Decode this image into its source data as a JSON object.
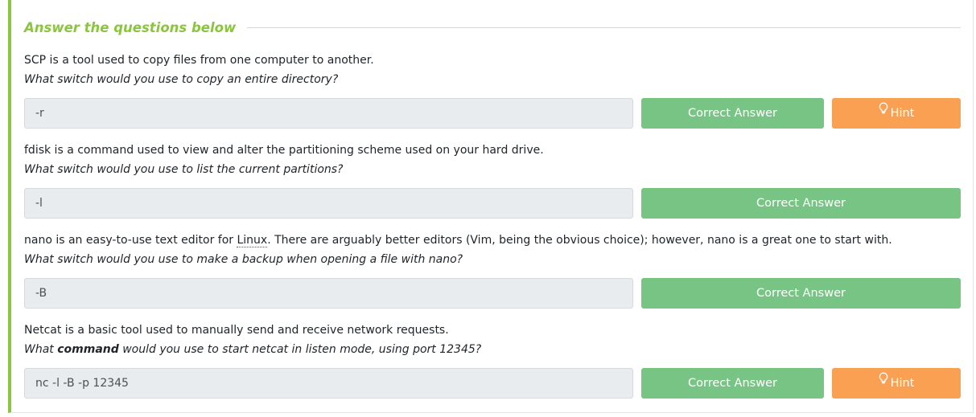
{
  "section": {
    "heading": "Answer the questions below"
  },
  "questions": [
    {
      "text": "SCP is a tool used to copy files from one computer to another.",
      "ask": "What switch would you use to copy an entire directory?",
      "answer": "-r",
      "button": "Correct Answer",
      "hint": "Hint"
    },
    {
      "text": "fdisk is a command used to view and alter the partitioning scheme used on your hard drive.",
      "ask": "What switch would you use to list the current partitions?",
      "answer": "-l",
      "button": "Correct Answer"
    },
    {
      "text_before": "nano is an easy-to-use text editor for ",
      "text_link": "Linux",
      "text_after": ". There are arguably better editors (Vim, being the obvious choice); however, nano is a great one to start with.",
      "ask": "What switch would you use to make a backup when opening a file with nano?",
      "answer": "-B",
      "button": "Correct Answer"
    },
    {
      "text": "Netcat is a basic tool used to manually send and receive network requests.",
      "ask_before": "What ",
      "ask_bold": "command",
      "ask_after": " would you use to start netcat in listen mode, using port 12345?",
      "answer": "nc -l -B -p 12345",
      "button": "Correct Answer",
      "hint": "Hint"
    }
  ],
  "colors": {
    "accent": "#8bc53f",
    "correct": "#78c485",
    "hint": "#f9a052"
  },
  "icons": {
    "hint": "lightbulb-icon"
  }
}
